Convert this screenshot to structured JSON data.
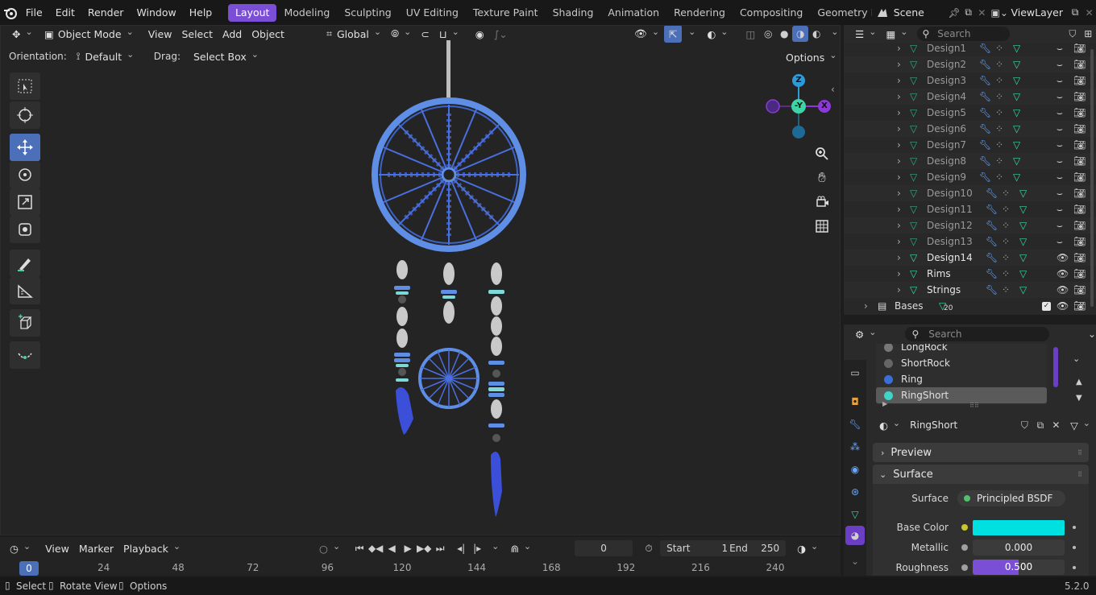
{
  "menu": [
    "File",
    "Edit",
    "Render",
    "Window",
    "Help"
  ],
  "workspaces": [
    "Layout",
    "Modeling",
    "Sculpting",
    "UV Editing",
    "Texture Paint",
    "Shading",
    "Animation",
    "Rendering",
    "Compositing",
    "Geometry Node"
  ],
  "scene": "Scene",
  "view_layer": "ViewLayer",
  "viewport": {
    "mode": "Object Mode",
    "menus": [
      "View",
      "Select",
      "Add",
      "Object"
    ],
    "transform_space": "Global",
    "orientation_label": "Orientation:",
    "orientation_value": "Default",
    "drag_label": "Drag:",
    "drag_value": "Select Box",
    "options": "Options",
    "gizmo": {
      "z": "Z",
      "y": "-Y",
      "x": "X"
    }
  },
  "outliner": {
    "search_placeholder": "Search",
    "items": [
      {
        "name": "Design1"
      },
      {
        "name": "Design2"
      },
      {
        "name": "Design3"
      },
      {
        "name": "Design4"
      },
      {
        "name": "Design5"
      },
      {
        "name": "Design6"
      },
      {
        "name": "Design7"
      },
      {
        "name": "Design8"
      },
      {
        "name": "Design9"
      },
      {
        "name": "Design10"
      },
      {
        "name": "Design11"
      },
      {
        "name": "Design12"
      },
      {
        "name": "Design13"
      },
      {
        "name": "Design14"
      },
      {
        "name": "Rims"
      },
      {
        "name": "Strings"
      }
    ],
    "collection": {
      "name": "Bases",
      "count": "20"
    }
  },
  "properties": {
    "search_placeholder": "Search",
    "materials": [
      "LongRock",
      "ShortRock",
      "Ring",
      "RingShort"
    ],
    "selected_material": "RingShort",
    "panels": {
      "preview": "Preview",
      "surface": "Surface"
    },
    "surface_label": "Surface",
    "surface_value": "Principled BSDF",
    "base_color_label": "Base Color",
    "base_color": "#00e0e0",
    "metallic_label": "Metallic",
    "metallic_value": "0.000",
    "roughness_label": "Roughness",
    "roughness_value": "0.500",
    "roughness_fraction": 0.5
  },
  "timeline": {
    "menus": [
      "View",
      "Marker",
      "Playback"
    ],
    "current_frame": "0",
    "start_label": "Start",
    "start_value": "1",
    "end_label": "End",
    "end_value": "250",
    "ruler": [
      "0",
      "24",
      "48",
      "72",
      "96",
      "120",
      "144",
      "168",
      "192",
      "216",
      "240"
    ]
  },
  "status": {
    "select": "Select",
    "rotate": "Rotate View",
    "options": "Options",
    "version": "5.2.0"
  },
  "colors": {
    "accent": "#7a4fd6",
    "select_blue": "#4b70b9",
    "mesh_green": "#3ed4a5"
  }
}
